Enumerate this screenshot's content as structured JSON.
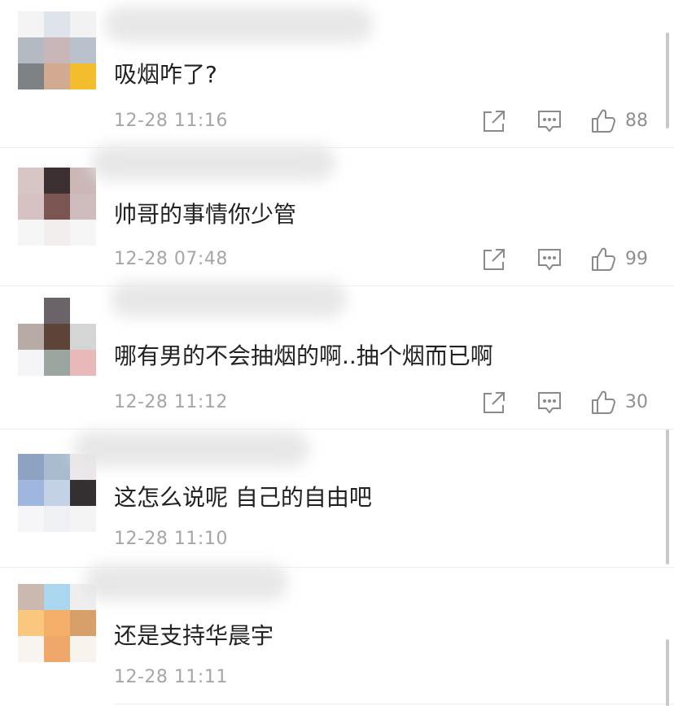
{
  "comments": [
    {
      "text": "吸烟咋了?",
      "time": "12-28 11:16",
      "likes": "88",
      "has_actions": true,
      "avatar": [
        "#f4f4f4",
        "#dfe4ea",
        "#f2f2f2",
        "#b4bac2",
        "#c8b6b8",
        "#b9c2cc",
        "#7f8285",
        "#d2aa92",
        "#f3bd2d"
      ]
    },
    {
      "text": "帅哥的事情你少管",
      "time": "12-28 07:48",
      "likes": "99",
      "has_actions": true,
      "avatar": [
        "#d8c5c5",
        "#3b2f31",
        "#cbb8b6",
        "#d6c2c2",
        "#7a5552",
        "#cfbdbd",
        "#f6f6f6",
        "#f2eeee",
        "#f6f6f6"
      ]
    },
    {
      "text": "哪有男的不会抽烟的啊..抽个烟而已啊",
      "time": "12-28 11:12",
      "likes": "30",
      "has_actions": true,
      "avatar": [
        "#ffffff",
        "#6a6468",
        "#ffffff",
        "#b8aaa5",
        "#5c4538",
        "#d3d6d4",
        "#f5f5f7",
        "#9aa69f",
        "#e9b8b8"
      ]
    },
    {
      "text": "这怎么说呢 自己的自由吧",
      "time": "12-28 11:10",
      "likes": "",
      "has_actions": false,
      "avatar": [
        "#8ea2c2",
        "#a9bccf",
        "#ebe7ea",
        "#9fb7de",
        "#c3d3e5",
        "#342f31",
        "#f6f6f8",
        "#eef0f4",
        "#f4f4f4"
      ]
    },
    {
      "text": "还是支持华晨宇",
      "time": "12-28 11:11",
      "likes": "",
      "has_actions": false,
      "avatar": [
        "#cbb9b0",
        "#aad7ef",
        "#eeeeee",
        "#fac77e",
        "#f4b06a",
        "#d79f6a",
        "#f8f5f0",
        "#f0a76a",
        "#f7f4ee"
      ]
    }
  ],
  "icons": {
    "share": "share-icon",
    "reply": "comment-icon",
    "like": "thumbs-up-icon"
  }
}
